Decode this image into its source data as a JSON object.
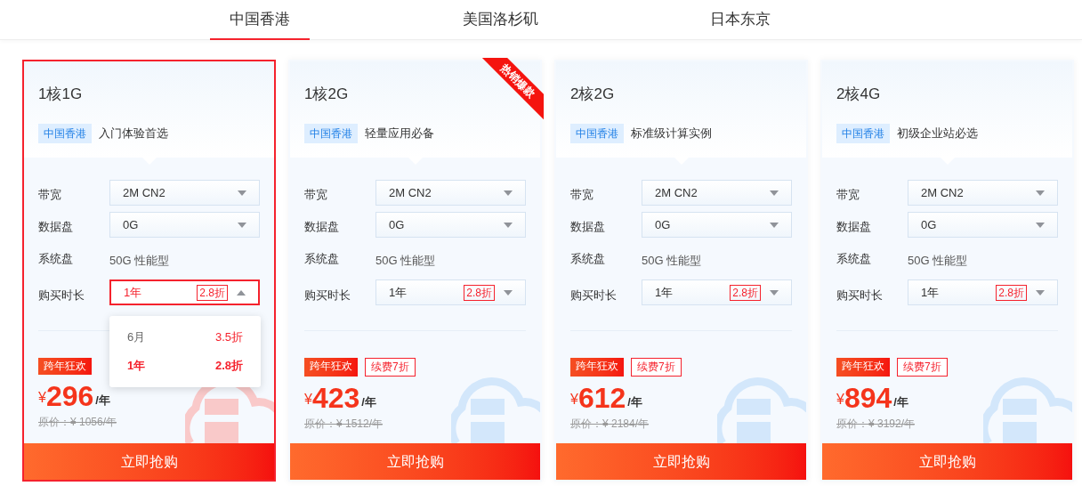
{
  "tabs": [
    {
      "label": "中国香港",
      "selected": true
    },
    {
      "label": "美国洛杉矶",
      "selected": false
    },
    {
      "label": "日本东京",
      "selected": false
    }
  ],
  "cards": [
    {
      "title": "1核1G",
      "selected": true,
      "region": "中国香港",
      "slogan": "入门体验首选",
      "fields": [
        {
          "label": "带宽",
          "kind": "select",
          "value": "2M CN2"
        },
        {
          "label": "数据盘",
          "kind": "select",
          "value": "0G"
        },
        {
          "label": "系统盘",
          "kind": "text",
          "value": "50G 性能型"
        }
      ],
      "duration": {
        "label": "购买时长",
        "value": "1年",
        "discount": "2.8折",
        "expanded": true,
        "options": [
          {
            "label": "6月",
            "discount": "3.5折",
            "selected": false
          },
          {
            "label": "1年",
            "discount": "2.8折",
            "selected": true
          }
        ]
      },
      "promos": [
        "跨年狂欢"
      ],
      "currency": "¥",
      "price": "296",
      "unit": "/年",
      "original": "原价：¥ 1056/年",
      "buy": "立即抢购"
    },
    {
      "title": "1核2G",
      "selected": false,
      "ribbon": "热销爆款",
      "region": "中国香港",
      "slogan": "轻量应用必备",
      "fields": [
        {
          "label": "带宽",
          "kind": "select",
          "value": "2M CN2"
        },
        {
          "label": "数据盘",
          "kind": "select",
          "value": "0G"
        },
        {
          "label": "系统盘",
          "kind": "text",
          "value": "50G 性能型"
        }
      ],
      "duration": {
        "label": "购买时长",
        "value": "1年",
        "discount": "2.8折",
        "expanded": false
      },
      "promos": [
        "跨年狂欢",
        "续费7折"
      ],
      "currency": "¥",
      "price": "423",
      "unit": "/年",
      "original": "原价：¥ 1512/年",
      "buy": "立即抢购"
    },
    {
      "title": "2核2G",
      "selected": false,
      "region": "中国香港",
      "slogan": "标准级计算实例",
      "fields": [
        {
          "label": "带宽",
          "kind": "select",
          "value": "2M CN2"
        },
        {
          "label": "数据盘",
          "kind": "select",
          "value": "0G"
        },
        {
          "label": "系统盘",
          "kind": "text",
          "value": "50G 性能型"
        }
      ],
      "duration": {
        "label": "购买时长",
        "value": "1年",
        "discount": "2.8折",
        "expanded": false
      },
      "promos": [
        "跨年狂欢",
        "续费7折"
      ],
      "currency": "¥",
      "price": "612",
      "unit": "/年",
      "original": "原价：¥ 2184/年",
      "buy": "立即抢购"
    },
    {
      "title": "2核4G",
      "selected": false,
      "region": "中国香港",
      "slogan": "初级企业站必选",
      "fields": [
        {
          "label": "带宽",
          "kind": "select",
          "value": "2M CN2"
        },
        {
          "label": "数据盘",
          "kind": "select",
          "value": "0G"
        },
        {
          "label": "系统盘",
          "kind": "text",
          "value": "50G 性能型"
        }
      ],
      "duration": {
        "label": "购买时长",
        "value": "1年",
        "discount": "2.8折",
        "expanded": false
      },
      "promos": [
        "跨年狂欢",
        "续费7折"
      ],
      "currency": "¥",
      "price": "894",
      "unit": "/年",
      "original": "原价：¥ 3192/年",
      "buy": "立即抢购"
    }
  ]
}
